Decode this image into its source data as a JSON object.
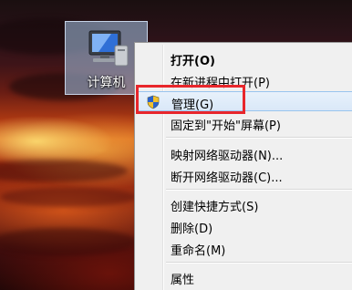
{
  "desktop": {
    "computer_icon": {
      "label": "计算机",
      "icon": "computer-icon"
    }
  },
  "context_menu": {
    "items": [
      {
        "label": "打开(O)",
        "bold": true
      },
      {
        "label": "在新进程中打开(P)"
      },
      {
        "label": "管理(G)",
        "icon": "shield-icon",
        "hovered": true
      },
      {
        "label": "固定到\"开始\"屏幕(P)"
      },
      {
        "label": "映射网络驱动器(N)..."
      },
      {
        "label": "断开网络驱动器(C)..."
      },
      {
        "label": "创建快捷方式(S)"
      },
      {
        "label": "删除(D)"
      },
      {
        "label": "重命名(M)"
      },
      {
        "label": "属性"
      }
    ]
  },
  "annotation": {
    "highlight_color": "#e8262b"
  }
}
